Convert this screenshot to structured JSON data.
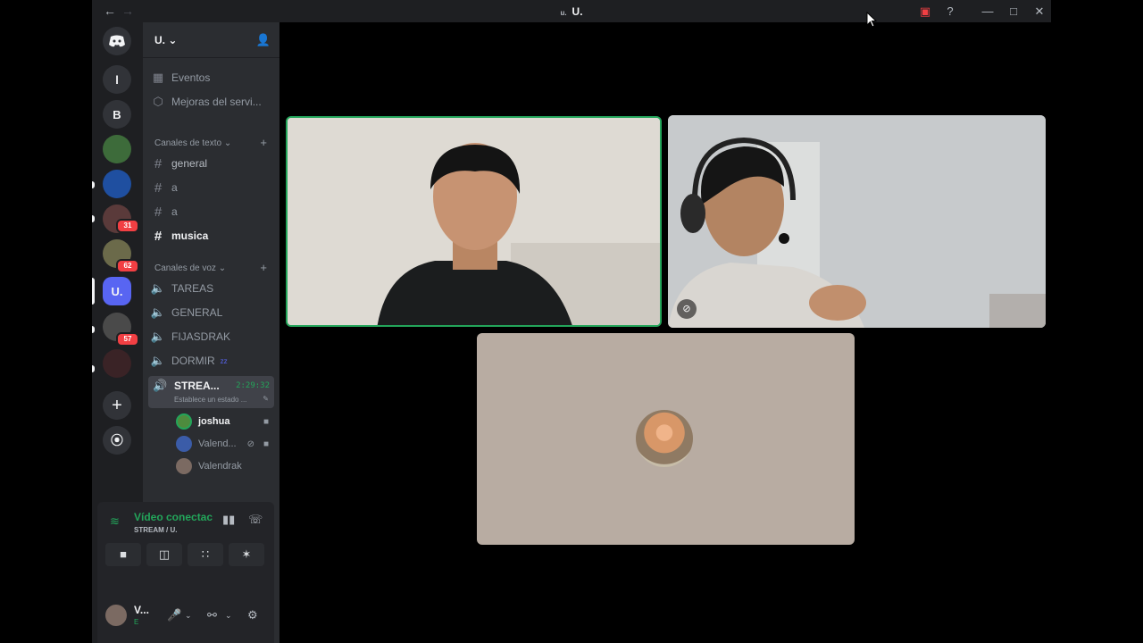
{
  "window": {
    "title_small": "u.",
    "title": "U.",
    "back_icon": "arrow-left-icon",
    "forward_icon": "arrow-right-icon"
  },
  "rail": {
    "servers": [
      {
        "label": "l"
      },
      {
        "label": "B"
      },
      {
        "label": ""
      },
      {
        "label": ""
      },
      {
        "label": "",
        "badge": "31"
      },
      {
        "label": "",
        "badge": "62"
      },
      {
        "label": "U.",
        "active": true
      },
      {
        "label": "",
        "badge": "57"
      },
      {
        "label": ""
      }
    ]
  },
  "sidebar": {
    "server_name": "U.",
    "events_label": "Eventos",
    "boosts_label": "Mejoras del servi...",
    "text_category": "Canales de texto",
    "text_channels": [
      "general",
      "a",
      "a",
      "musica"
    ],
    "voice_category": "Canales de voz",
    "voice_channels": [
      "TAREAS",
      "GENERAL",
      "FIJASDRAK",
      "DORMIR"
    ],
    "dormir_suffix": "zz",
    "active_channel": {
      "name": "STREA...",
      "time": "2:29:32",
      "status": "Establece un estado ..."
    },
    "members": [
      {
        "name": "joshua",
        "color": "#4e8b3e"
      },
      {
        "name": "Valend...",
        "color": "#3b5ca8"
      },
      {
        "name": "Valendrak",
        "color": "#7b6a62"
      }
    ]
  },
  "voice_panel": {
    "status": "Vídeo conectac",
    "channel": "STREAM / U."
  },
  "user": {
    "name": "V...",
    "status": "E"
  },
  "colors": {
    "accent": "#5865f2",
    "online": "#23a55a",
    "badge": "#f23f43"
  }
}
